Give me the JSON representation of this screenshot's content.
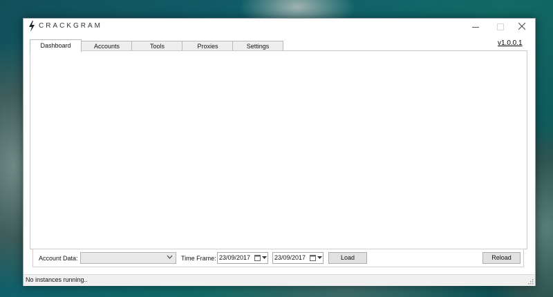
{
  "app": {
    "title": "CRACKGRAM",
    "version": "v1.0.0.1",
    "icons": {
      "app": "lightning-bolt-icon",
      "minimize": "minimize-icon",
      "maximize": "maximize-icon",
      "close": "close-icon"
    }
  },
  "tabs": [
    {
      "label": "Dashboard",
      "active": true
    },
    {
      "label": "Accounts",
      "active": false
    },
    {
      "label": "Tools",
      "active": false
    },
    {
      "label": "Proxies",
      "active": false
    },
    {
      "label": "Settings",
      "active": false
    }
  ],
  "bottom_bar": {
    "account_data_label": "Account Data:",
    "account_data_value": "",
    "time_frame_label": "Time Frame:",
    "date_from": "23/09/2017",
    "date_to": "23/09/2017",
    "load_label": "Load",
    "reload_label": "Reload"
  },
  "status": {
    "text": "No instances running.."
  }
}
